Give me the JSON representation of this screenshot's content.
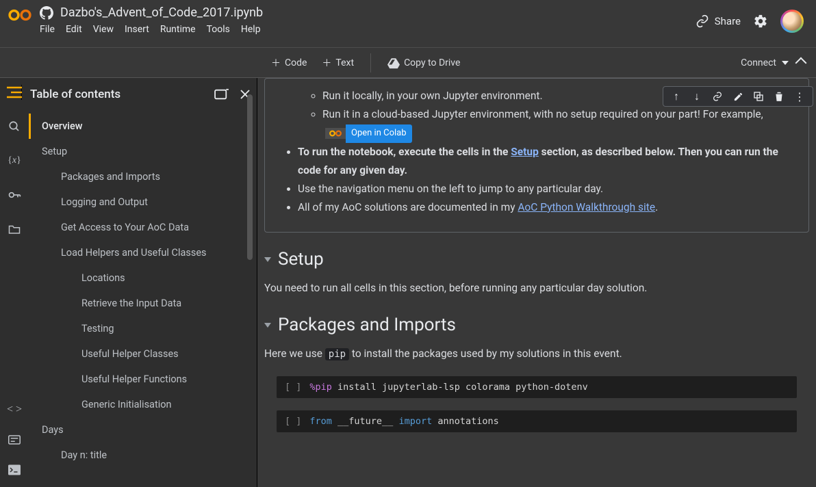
{
  "header": {
    "title": "Dazbo's_Advent_of_Code_2017.ipynb",
    "menus": [
      "File",
      "Edit",
      "View",
      "Insert",
      "Runtime",
      "Tools",
      "Help"
    ],
    "share": "Share"
  },
  "subbar": {
    "code": "Code",
    "text": "Text",
    "copy": "Copy to Drive",
    "connect": "Connect"
  },
  "toc": {
    "title": "Table of contents",
    "items": [
      {
        "label": "Overview",
        "level": 1,
        "active": true
      },
      {
        "label": "Setup",
        "level": 1
      },
      {
        "label": "Packages and Imports",
        "level": 2
      },
      {
        "label": "Logging and Output",
        "level": 2
      },
      {
        "label": "Get Access to Your AoC Data",
        "level": 2
      },
      {
        "label": "Load Helpers and Useful Classes",
        "level": 2
      },
      {
        "label": "Locations",
        "level": 3
      },
      {
        "label": "Retrieve the Input Data",
        "level": 3
      },
      {
        "label": "Testing",
        "level": 3
      },
      {
        "label": "Useful Helper Classes",
        "level": 3
      },
      {
        "label": "Useful Helper Functions",
        "level": 3
      },
      {
        "label": "Generic Initialisation",
        "level": 3
      },
      {
        "label": "Days",
        "level": 1
      },
      {
        "label": "Day n: title",
        "level": 2
      }
    ]
  },
  "overview": {
    "b1": "Run it locally, in your own Jupyter environment.",
    "b2a": "Run it in a cloud-based Jupyter environment, with no setup required on your part! For example, ",
    "badge": "Open in Colab",
    "b3a": "To run the notebook, execute the cells in the ",
    "b3link": "Setup",
    "b3b": " section, as described below. Then you can run the code for any given day.",
    "b4": "Use the navigation menu on the left to jump to any particular day.",
    "b5a": "All of my AoC solutions are documented in my ",
    "b5link": "AoC Python Walkthrough site",
    "b5b": "."
  },
  "setup": {
    "h": "Setup",
    "p": "You need to run all cells in this section, before running any particular day solution."
  },
  "pkg": {
    "h": "Packages and Imports",
    "p1": "Here we use ",
    "pcode": "pip",
    "p2": " to install the packages used by my solutions in this event."
  },
  "code1": {
    "gut": "[ ]",
    "magic": "%pip",
    "rest": " install jupyterlab-lsp colorama python-dotenv"
  },
  "code2": {
    "gut": "[ ]",
    "k1": "from",
    "m1": " __future__ ",
    "k2": "import",
    "m2": " annotations"
  }
}
